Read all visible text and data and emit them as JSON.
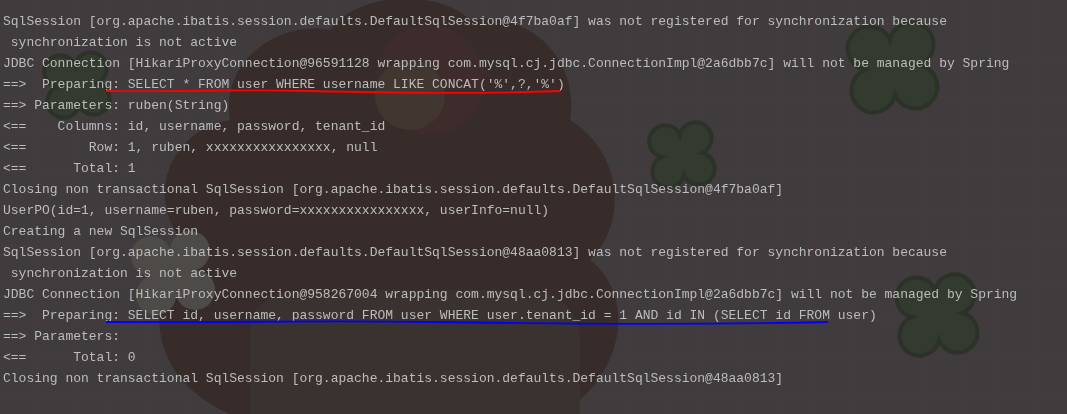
{
  "console": {
    "lines": [
      {
        "text": "SqlSession [org.apache.ibatis.session.defaults.DefaultSqlSession@4f7ba0af] was not registered for synchronization because"
      },
      {
        "text": " synchronization is not active"
      },
      {
        "text": "JDBC Connection [HikariProxyConnection@96591128 wrapping com.mysql.cj.jdbc.ConnectionImpl@2a6dbb7c] will not be managed by Spring"
      },
      {
        "text": "==>  Preparing: SELECT * FROM user WHERE username LIKE CONCAT('%',?,'%')",
        "underline": {
          "color": "#ff0000"
        }
      },
      {
        "text": "==> Parameters: ruben(String)"
      },
      {
        "text": "<==    Columns: id, username, password, tenant_id"
      },
      {
        "text": "<==        Row: 1, ruben, xxxxxxxxxxxxxxxx, null"
      },
      {
        "text": "<==      Total: 1"
      },
      {
        "text": "Closing non transactional SqlSession [org.apache.ibatis.session.defaults.DefaultSqlSession@4f7ba0af]"
      },
      {
        "text": "UserPO(id=1, username=ruben, password=xxxxxxxxxxxxxxxx, userInfo=null)"
      },
      {
        "text": "Creating a new SqlSession"
      },
      {
        "text": "SqlSession [org.apache.ibatis.session.defaults.DefaultSqlSession@48aa0813] was not registered for synchronization because"
      },
      {
        "text": " synchronization is not active"
      },
      {
        "text": "JDBC Connection [HikariProxyConnection@958267004 wrapping com.mysql.cj.jdbc.ConnectionImpl@2a6dbb7c] will not be managed by Spring"
      },
      {
        "text": "==>  Preparing: SELECT id, username, password FROM user WHERE user.tenant_id = 1 AND id IN (SELECT id FROM user)",
        "underline": {
          "color": "#0000ff"
        }
      },
      {
        "text": "==> Parameters: "
      },
      {
        "text": "<==      Total: 0"
      },
      {
        "text": "Closing non transactional SqlSession [org.apache.ibatis.session.defaults.DefaultSqlSession@48aa0813]"
      }
    ]
  }
}
